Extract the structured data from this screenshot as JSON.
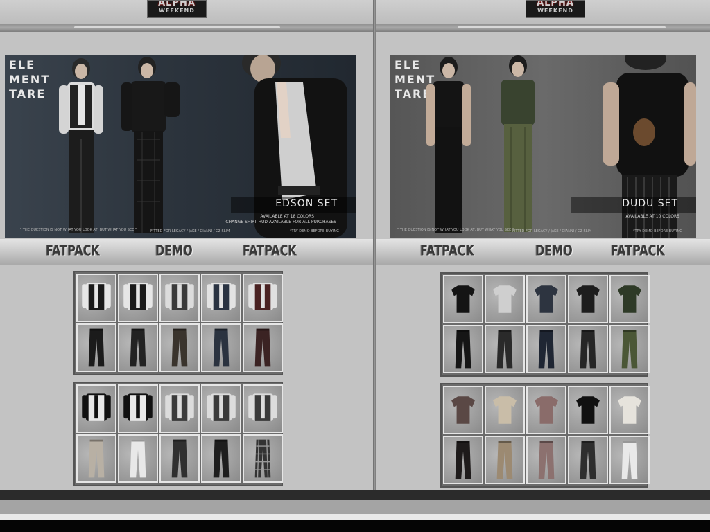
{
  "scene": {
    "colors": {
      "wall": "#c3c3c3",
      "rail": "#8e8e8e",
      "frame": "#6b6b6b",
      "cell_bg": "#9e9e9e"
    }
  },
  "booths": [
    {
      "id": "edson",
      "sign": {
        "line1": "ALPHA",
        "line2": "WEEKEND"
      },
      "poster": {
        "brand_lines": [
          "ELE",
          "MENT",
          "TARE"
        ],
        "set_name": "EDSON SET",
        "availability": "AVAILABLE AT 18 COLORS",
        "hud_note": "CHANGE SHIRT HUD AVAILABLE FOR ALL PURCHASES",
        "quote": "\" THE QUESTION IS NOT WHAT YOU LOOK AT, BUT WHAT YOU SEE \"",
        "bodies": "FITTED FOR LEGACY / JAKE / GIANNI / CZ SLIM",
        "demo_note": "*TRY DEMO BEFORE BUYING"
      },
      "buttons": {
        "fatpack_left": "FATPACK",
        "demo": "DEMO",
        "fatpack_right": "FATPACK"
      },
      "items_top_row": [
        "vest-white",
        "vest-white",
        "vest-grey",
        "vest-blue",
        "vest-red"
      ],
      "items_top_pants": [
        "#1b1b1b",
        "#222",
        "#3a342d",
        "#2b3340",
        "#3b2323"
      ],
      "items_bottom_row": [
        "vest-black",
        "vest-black",
        "vest-grey",
        "vest-grey",
        "vest-grey"
      ],
      "items_bottom_pants": [
        "#b8b0a4",
        "#e8e8e8",
        "#303030",
        "#1e1e1e",
        "plaid"
      ]
    },
    {
      "id": "dudu",
      "sign": {
        "line1": "ALPHA",
        "line2": "WEEKEND"
      },
      "poster": {
        "brand_lines": [
          "ELE",
          "MENT",
          "TARE"
        ],
        "set_name": "DUDU SET",
        "availability": "AVAILABLE AT 10 COLORS",
        "quote": "\" THE QUESTION IS NOT WHAT YOU LOOK AT, BUT WHAT YOU SEE \"",
        "bodies": "FITTED FOR LEGACY / JAKE / GIANNI / CZ SLIM",
        "demo_note": "*TRY DEMO BEFORE BUYING"
      },
      "buttons": {
        "fatpack_left": "FATPACK",
        "demo": "DEMO",
        "fatpack_right": "FATPACK"
      },
      "items_top_row": [
        "#141414",
        "#cfcfcf",
        "#2d3440",
        "#1d1d1d",
        "#2e3a27"
      ],
      "items_top_pants": [
        "#151515",
        "#2a2a2a",
        "#1f2633",
        "#262626",
        "#4b5736"
      ],
      "items_bottom_row": [
        "#5a4845",
        "#c9bda8",
        "#8a6c6a",
        "#111111",
        "#e6e3dc"
      ],
      "items_bottom_pants": [
        "#1e1b1b",
        "#9c8a72",
        "#8c716f",
        "#2e2e2e",
        "#e9e9e9"
      ]
    }
  ]
}
